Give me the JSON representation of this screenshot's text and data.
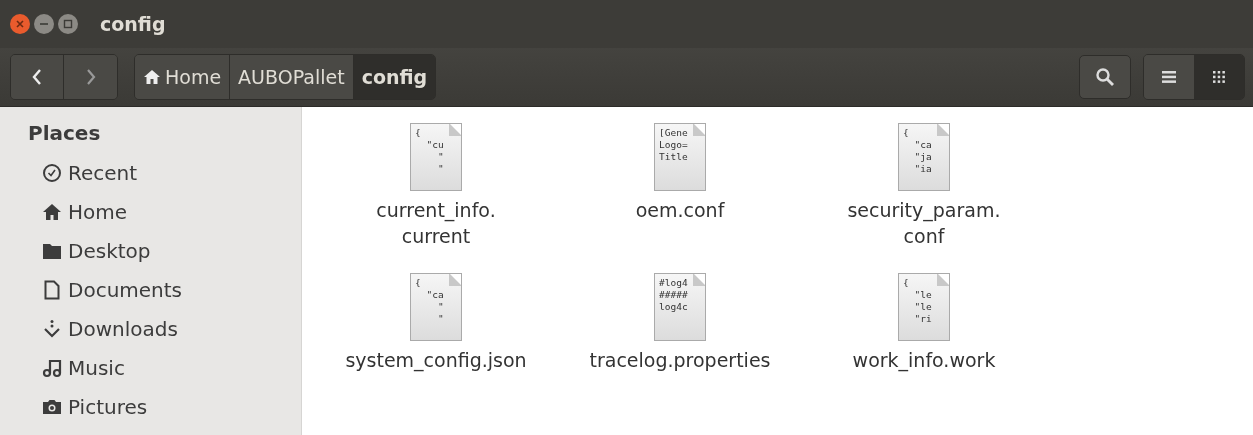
{
  "window": {
    "title": "config"
  },
  "breadcrumbs": [
    {
      "label": "Home",
      "kind": "home",
      "selected": false
    },
    {
      "label": "AUBOPallet",
      "kind": "folder",
      "selected": false
    },
    {
      "label": "config",
      "kind": "folder",
      "selected": true
    }
  ],
  "view_buttons": [
    {
      "kind": "list",
      "selected": false
    },
    {
      "kind": "grid",
      "selected": true
    }
  ],
  "sidebar": {
    "heading": "Places",
    "items": [
      {
        "label": "Recent",
        "kind": "recent"
      },
      {
        "label": "Home",
        "kind": "home"
      },
      {
        "label": "Desktop",
        "kind": "desktop"
      },
      {
        "label": "Documents",
        "kind": "documents"
      },
      {
        "label": "Downloads",
        "kind": "downloads"
      },
      {
        "label": "Music",
        "kind": "music"
      },
      {
        "label": "Pictures",
        "kind": "pictures"
      }
    ]
  },
  "files": [
    {
      "name": "current_info.\ncurrent",
      "preview": [
        "{",
        "  \"cu",
        "    \"",
        "    \""
      ]
    },
    {
      "name": "oem.conf",
      "preview": [
        "[Gene",
        "Logo=",
        "Title"
      ]
    },
    {
      "name": "security_param.\nconf",
      "preview": [
        "{",
        "  \"ca",
        "  \"ja",
        "  \"ia"
      ]
    },
    {
      "name": "system_config.json",
      "preview": [
        "{",
        "  \"ca",
        "    \"",
        "    \""
      ]
    },
    {
      "name": "tracelog.properties",
      "preview": [
        "#log4",
        "#####",
        "log4c"
      ]
    },
    {
      "name": "work_info.work",
      "preview": [
        "{",
        "  \"le",
        "  \"le",
        "  \"ri"
      ]
    }
  ]
}
